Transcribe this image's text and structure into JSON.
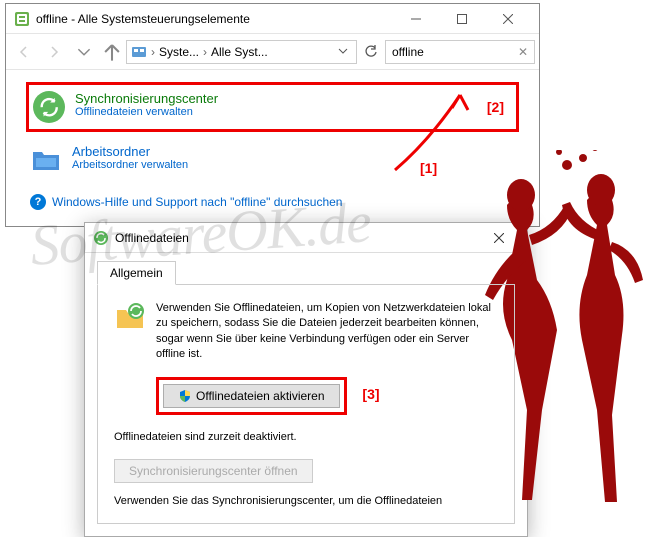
{
  "window": {
    "title": "offline - Alle Systemsteuerungselemente",
    "address": {
      "seg1": "Syste...",
      "seg2": "Alle Syst..."
    },
    "search_value": "offline"
  },
  "results": {
    "sync": {
      "title": "Synchronisierungscenter",
      "subtitle": "Offlinedateien verwalten"
    },
    "work": {
      "title": "Arbeitsordner",
      "subtitle": "Arbeitsordner verwalten"
    }
  },
  "help_link": "Windows-Hilfe und Support nach \"offline\" durchsuchen",
  "dialog": {
    "title": "Offlinedateien",
    "tab": "Allgemein",
    "description": "Verwenden Sie Offlinedateien, um Kopien von Netzwerkdateien lokal zu speichern, sodass Sie die Dateien jederzeit bearbeiten können, sogar wenn Sie über keine Verbindung verfügen oder ein Server offline ist.",
    "activate_label": "Offlinedateien aktivieren",
    "status": "Offlinedateien sind zurzeit deaktiviert.",
    "sync_open_label": "Synchronisierungscenter öffnen",
    "hint": "Verwenden Sie das Synchronisierungscenter, um die Offlinedateien"
  },
  "markers": {
    "m1": "[1]",
    "m2": "[2]",
    "m3": "[3]"
  },
  "watermark": "SoftwareOK.de"
}
